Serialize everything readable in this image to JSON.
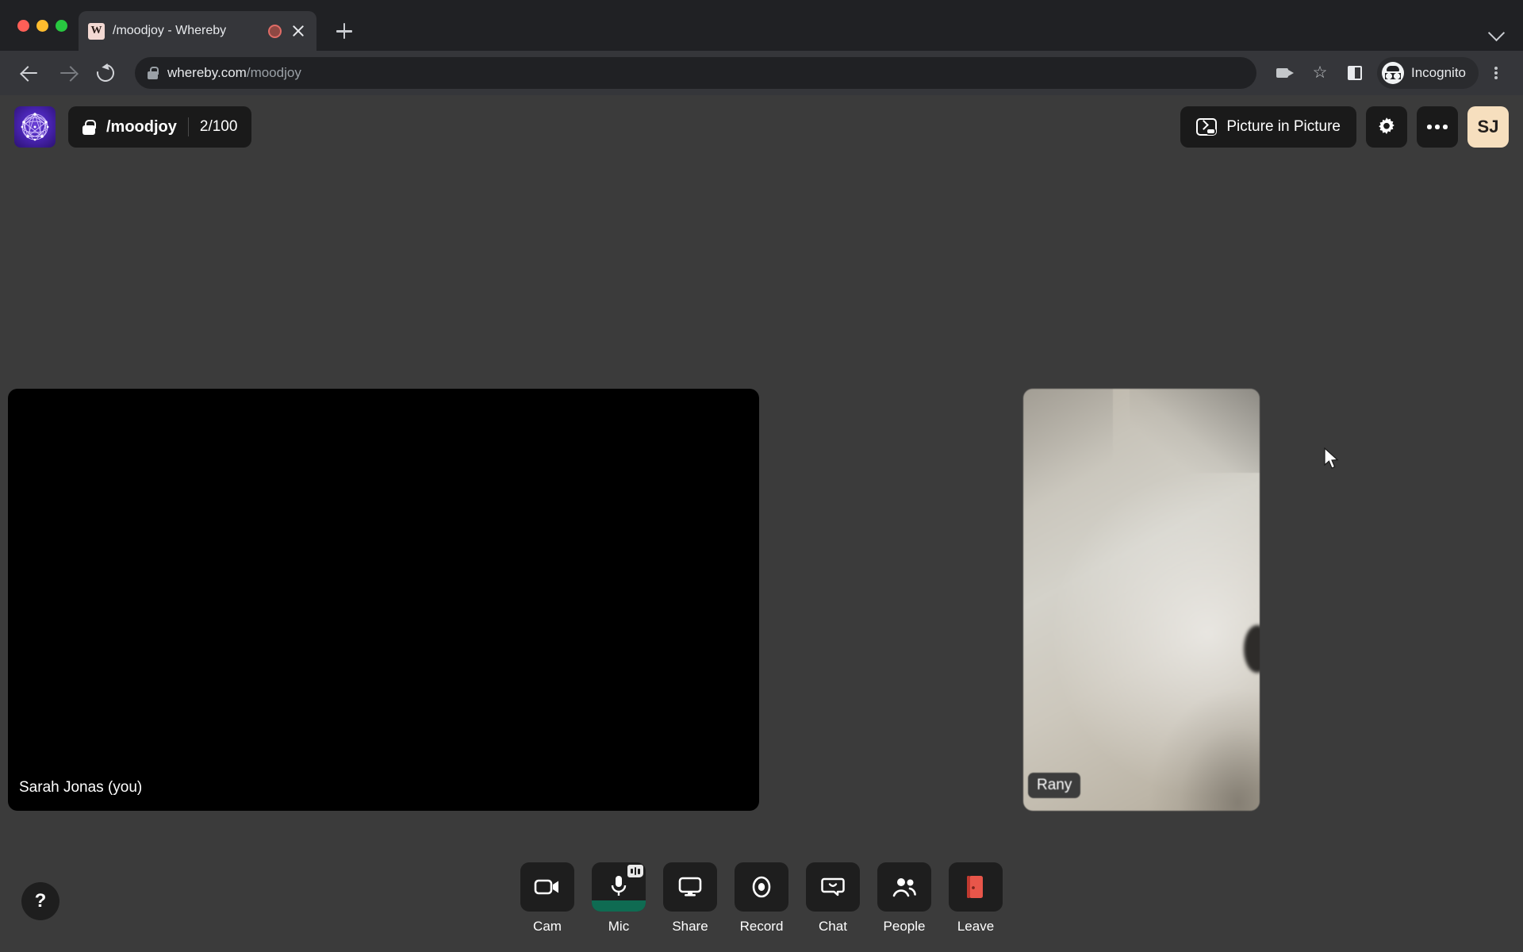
{
  "browser": {
    "tab": {
      "title": "/moodjoy - Whereby",
      "favicon_letter": "W",
      "recording_indicator": "recording-dot",
      "close_label": "x"
    },
    "newtab_label": "+",
    "address": {
      "host": "whereby.com",
      "path": "/moodjoy",
      "lock_icon": "lock-icon"
    },
    "profile": {
      "label": "Incognito"
    }
  },
  "app": {
    "room": {
      "name": "/moodjoy",
      "participants": "2/100",
      "lock_icon": "lock-icon"
    },
    "header_actions": {
      "pip_label": "Picture in Picture",
      "settings_icon": "gear-icon",
      "more_icon": "ellipsis-icon",
      "avatar_initials": "SJ",
      "avatar_color": "#f6dfbe"
    },
    "tiles": [
      {
        "name": "Sarah Jonas (you)",
        "style": "plain",
        "video": "off"
      },
      {
        "name": "Rany",
        "style": "pill",
        "video": "on"
      }
    ],
    "controls": [
      {
        "label": "Cam",
        "icon": "camera-icon",
        "state": "on"
      },
      {
        "label": "Mic",
        "icon": "microphone-icon",
        "state": "on",
        "level_color": "#0f6b52"
      },
      {
        "label": "Share",
        "icon": "screen-icon",
        "state": "off"
      },
      {
        "label": "Record",
        "icon": "record-icon",
        "state": "off"
      },
      {
        "label": "Chat",
        "icon": "chat-icon",
        "state": "off"
      },
      {
        "label": "People",
        "icon": "people-icon",
        "state": "off"
      },
      {
        "label": "Leave",
        "icon": "door-icon",
        "state": "off",
        "color": "#e8564a"
      }
    ],
    "help_label": "?"
  }
}
